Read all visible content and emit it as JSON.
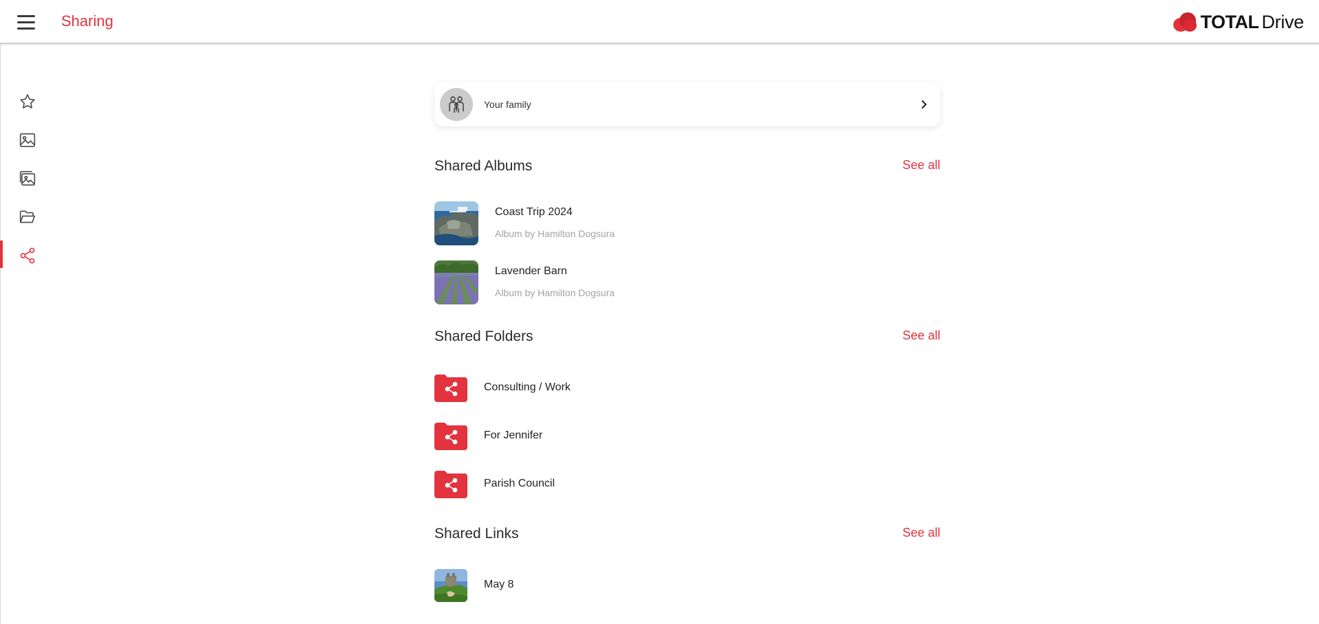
{
  "header": {
    "title": "Sharing",
    "brand_bold": "TOTAL",
    "brand_light": "Drive",
    "menu_icon": "hamburger-menu-icon"
  },
  "colors": {
    "accent": "#e2333f",
    "sidebar_icon": "#4a4a4a",
    "muted_text": "#a3a3a3"
  },
  "sidebar": {
    "items": [
      {
        "icon": "star-icon",
        "active": false
      },
      {
        "icon": "image-icon",
        "active": false
      },
      {
        "icon": "photo-album-icon",
        "active": false
      },
      {
        "icon": "folder-open-icon",
        "active": false
      },
      {
        "icon": "share-icon",
        "active": true
      }
    ]
  },
  "family": {
    "label": "Your family",
    "icon": "family-icon"
  },
  "shared_albums": {
    "title": "Shared Albums",
    "see_all": "See all",
    "items": [
      {
        "name": "Coast Trip 2024",
        "subtitle": "Album by Hamilton Dogsura"
      },
      {
        "name": "Lavender Barn",
        "subtitle": "Album by Hamilton Dogsura"
      }
    ]
  },
  "shared_folders": {
    "title": "Shared Folders",
    "see_all": "See all",
    "items": [
      {
        "name": "Consulting / Work"
      },
      {
        "name": "For Jennifer"
      },
      {
        "name": "Parish Council"
      }
    ]
  },
  "shared_links": {
    "title": "Shared Links",
    "see_all": "See all",
    "items": [
      {
        "name": "May 8"
      }
    ]
  }
}
